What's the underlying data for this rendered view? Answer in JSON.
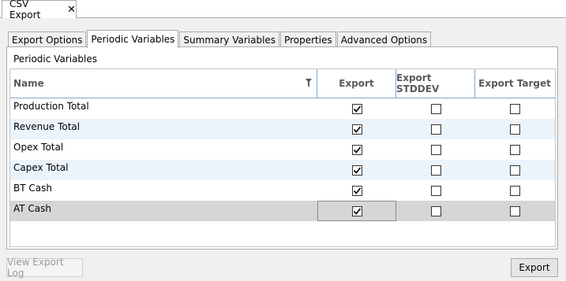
{
  "document": {
    "tab_title": "CSV Export",
    "close_glyph": "✕"
  },
  "tabs": [
    {
      "label": "Export Options",
      "selected": false
    },
    {
      "label": "Periodic Variables",
      "selected": true
    },
    {
      "label": "Summary Variables",
      "selected": false
    },
    {
      "label": "Properties",
      "selected": false
    },
    {
      "label": "Advanced Options",
      "selected": false
    }
  ],
  "panel": {
    "section_title": "Periodic Variables"
  },
  "grid": {
    "columns": [
      "Name",
      "Export",
      "Export STDDEV",
      "Export Target"
    ],
    "rows": [
      {
        "name": "Production Total",
        "export": true,
        "stddev": false,
        "target": false
      },
      {
        "name": "Revenue Total",
        "export": true,
        "stddev": false,
        "target": false
      },
      {
        "name": "Opex Total",
        "export": true,
        "stddev": false,
        "target": false
      },
      {
        "name": "Capex Total",
        "export": true,
        "stddev": false,
        "target": false
      },
      {
        "name": "BT Cash",
        "export": true,
        "stddev": false,
        "target": false
      },
      {
        "name": "AT Cash",
        "export": true,
        "stddev": false,
        "target": false,
        "selected": true
      }
    ]
  },
  "footer": {
    "view_log_label": "View Export Log",
    "export_label": "Export"
  },
  "colors": {
    "header_border": "#7fa6cf",
    "alt_row": "#ebf3fb",
    "selected_row": "#d6d6d6"
  }
}
